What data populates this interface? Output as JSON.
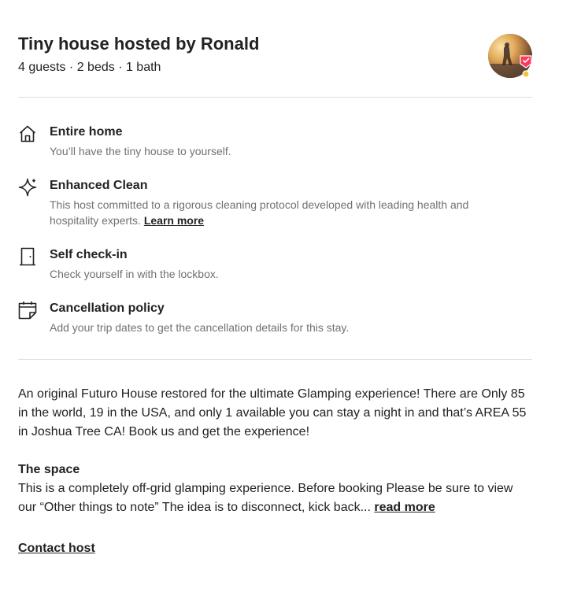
{
  "header": {
    "title": "Tiny house hosted by Ronald",
    "subtitle": "4 guests · 2 beds · 1 bath"
  },
  "highlights": [
    {
      "icon": "home-icon",
      "title": "Entire home",
      "description": "You’ll have the tiny house to yourself."
    },
    {
      "icon": "sparkle-icon",
      "title": "Enhanced Clean",
      "description": "This host committed to a rigorous cleaning protocol developed with leading health and hospitality experts.",
      "link": "Learn more"
    },
    {
      "icon": "door-icon",
      "title": "Self check-in",
      "description": "Check yourself in with the lockbox."
    },
    {
      "icon": "calendar-icon",
      "title": "Cancellation policy",
      "description": "Add your trip dates to get the cancellation details for this stay."
    }
  ],
  "description": {
    "text": "An original Futuro House restored for the ultimate Glamping experience! There are Only 85 in the world, 19 in the USA, and only 1 available you can stay a night in and that’s AREA 55 in Joshua Tree CA! Book us and get the experience!",
    "space_heading": "The space",
    "space_text": "This is a completely off-grid glamping experience. Before booking Please be sure to view our “Other things to note” The idea is to disconnect, kick back...",
    "read_more": "read more"
  },
  "contact_host": "Contact host",
  "colors": {
    "text": "#222222",
    "muted": "#717171",
    "divider": "#dddddd",
    "badge": "#ff385c"
  }
}
